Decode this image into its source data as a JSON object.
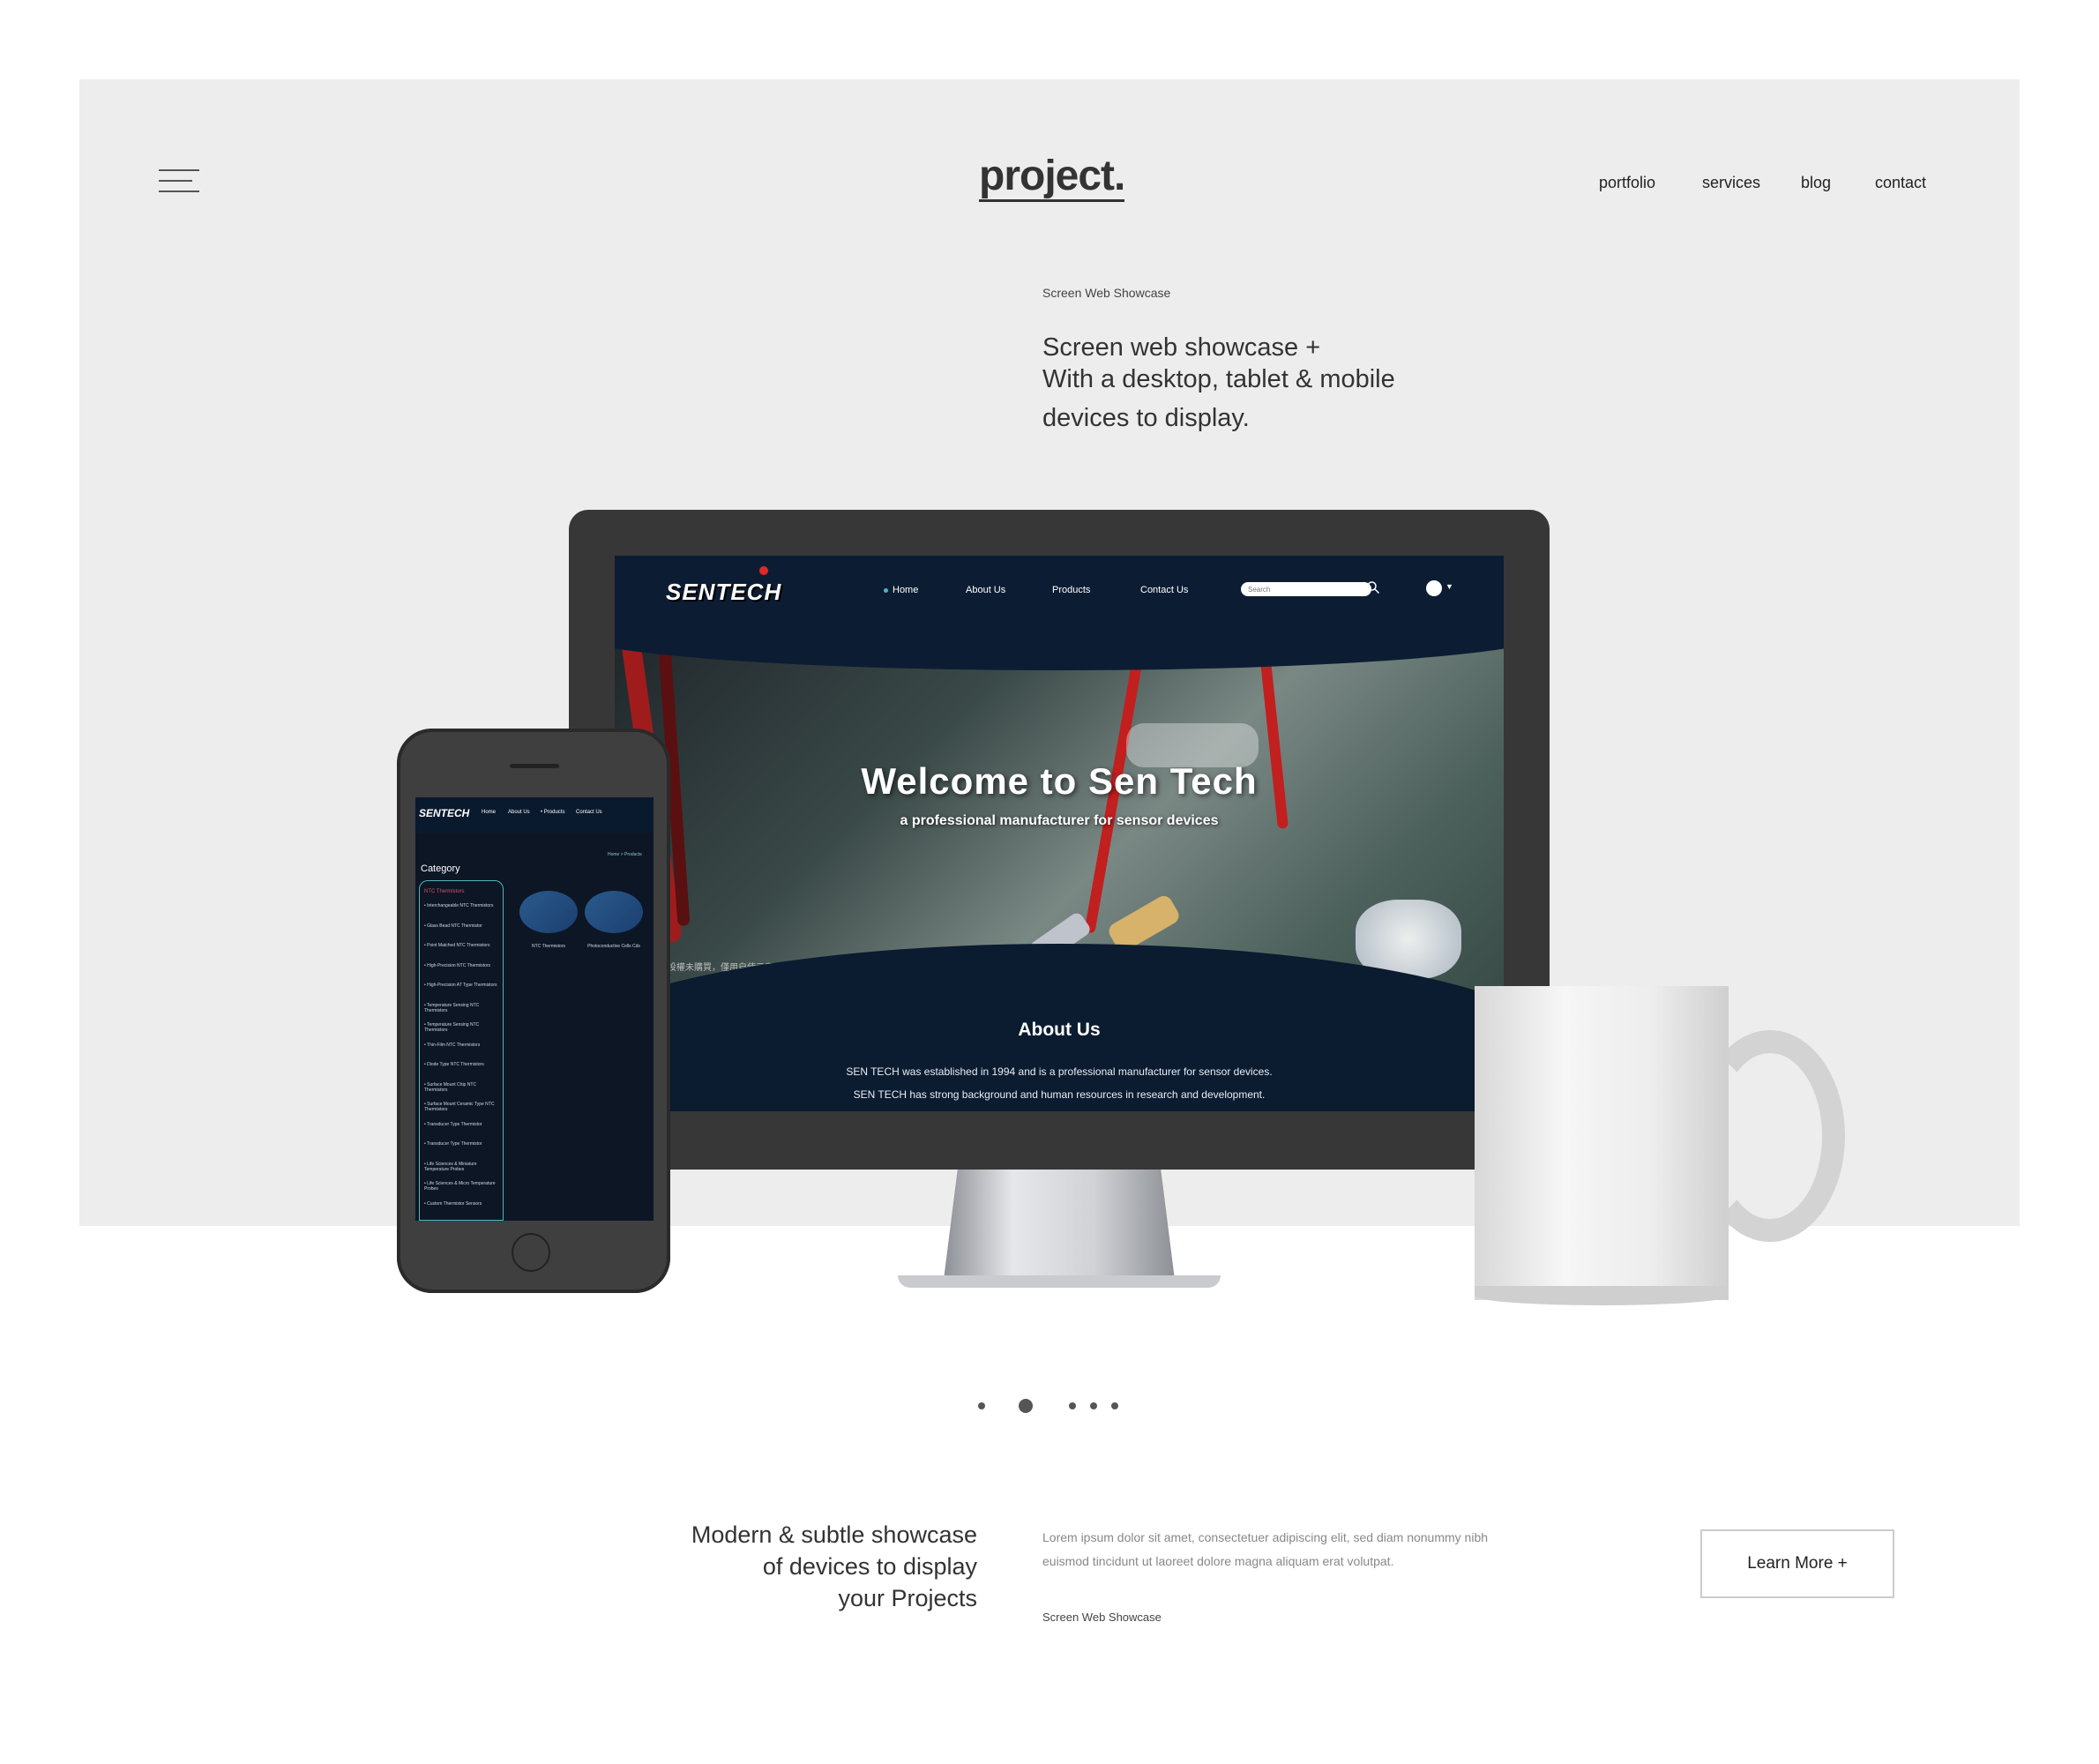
{
  "header": {
    "logo": "project.",
    "nav": [
      "portfolio",
      "services",
      "blog",
      "contact"
    ]
  },
  "intro": {
    "eyebrow": "Screen Web Showcase",
    "headline": [
      "Screen web showcase +",
      "With a desktop, tablet & mobile",
      "devices to display."
    ]
  },
  "desktop_site": {
    "logo": "SENTECH",
    "nav": [
      "Home",
      "About Us",
      "Products",
      "Contact Us"
    ],
    "search_placeholder": "Search",
    "hero_title": "Welcome  to  Sen Tech",
    "hero_subtitle": "a professional manufacturer for sensor devices",
    "chinese_text": "投權未購買，僅用自使示意",
    "about_title": "About Us",
    "about_lines": [
      "SEN TECH was established in 1994 and is a professional manufacturer for sensor devices.",
      "SEN TECH has strong background and human resources in research and development."
    ]
  },
  "mobile_site": {
    "logo": "SENTECH",
    "nav": [
      "Home",
      "About Us",
      "• Products",
      "Contact Us"
    ],
    "breadcrumb": "Home > Products",
    "category_title": "Category",
    "category_head": "NTC Thermistors",
    "categories": [
      "Interchangeable NTC Thermistors",
      "Glass Bead NTC Thermistor",
      "Point Matched NTC Thermistors",
      "High-Precision NTC Thermistors",
      "High-Precision AT Type Thermistors",
      "Temperature Sensing NTC Thermistors",
      "Temperature Sensing NTC Thermistors",
      "Thin-Film NTC Thermistors",
      "Diode Type NTC Thermistors",
      "Surface Mount Chip NTC Thermistors",
      "Surface Mount Ceramic Type NTC Thermistors",
      "Transducer Type Thermistor",
      "Transducer Type Thermistor",
      "Life Sciences & Miniature Temperature Probes",
      "Life Sciences & Micro Temperature Probes",
      "Custom Thermistor Sensors"
    ],
    "products": [
      "NTC Thermistors",
      "Photoconductive Cells Cds"
    ]
  },
  "carousel": {
    "count": 5,
    "active_index": 1
  },
  "bottom": {
    "tagline": [
      "Modern & subtle showcase",
      "of devices to display",
      "your Projects"
    ],
    "lorem": "Lorem ipsum dolor sit amet, consectetuer adipiscing elit, sed diam nonummy nibh euismod tincidunt ut laoreet dolore magna aliquam erat volutpat.",
    "eyebrow": "Screen Web Showcase",
    "button": "Learn More +"
  },
  "colors": {
    "panel": "#ededed",
    "site_navy": "#0c1d33",
    "accent_red": "#e02828",
    "accent_teal": "#4fb3c1"
  }
}
